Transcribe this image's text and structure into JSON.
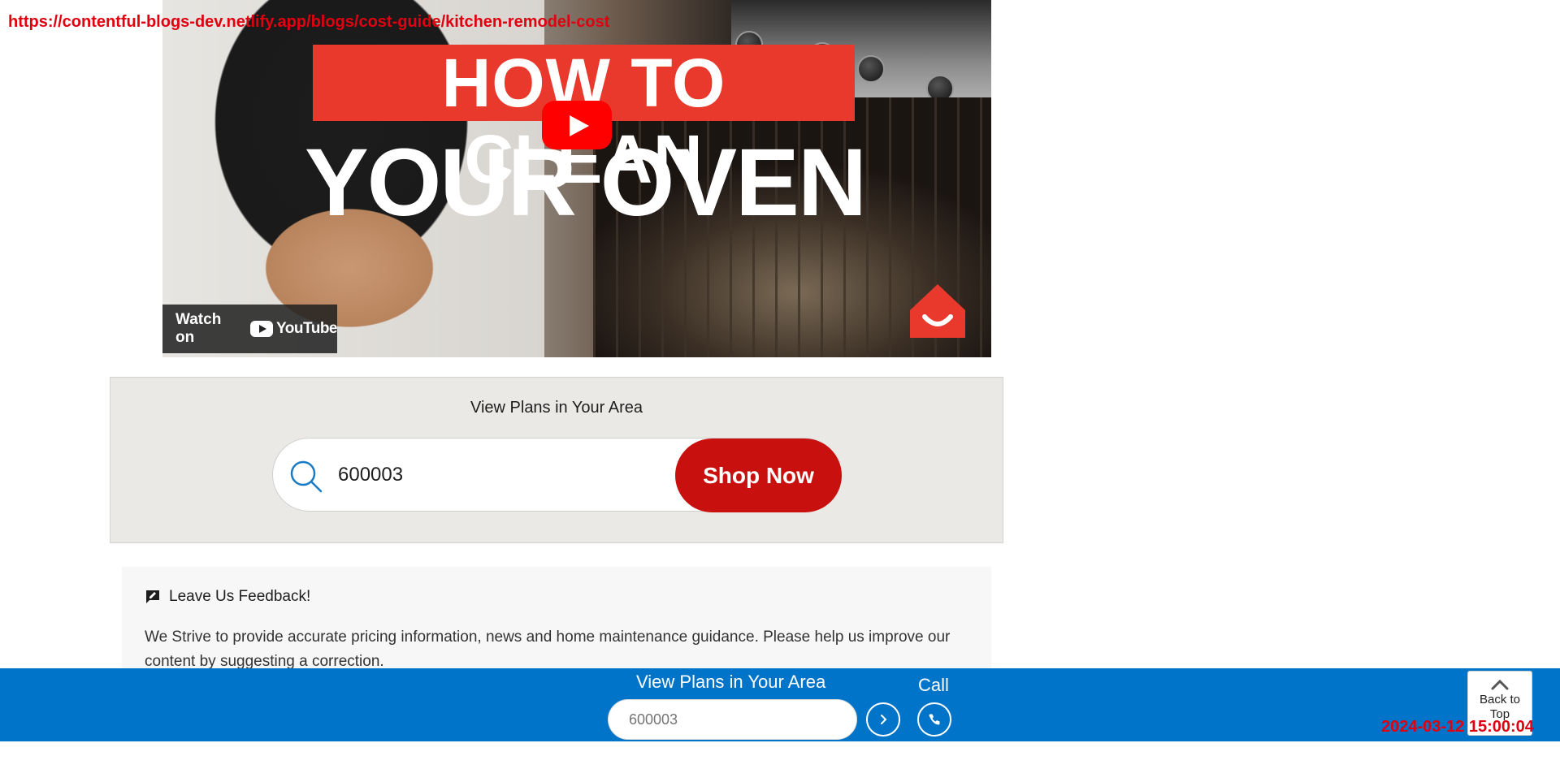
{
  "overlay": {
    "url": "https://contentful-blogs-dev.netlify.app/blogs/cost-guide/kitchen-remodel-cost",
    "timestamp": "2024-03-12 15:00:04"
  },
  "video": {
    "headline_line1": "HOW TO CLEAN",
    "headline_line2": "YOUR OVEN",
    "watch_on_label": "Watch on",
    "youtube_wordmark": "YouTube",
    "play_icon": "play-icon",
    "brand_icon": "house-smile-icon"
  },
  "plans": {
    "title": "View Plans in Your Area",
    "zip_value": "600003",
    "button_label": "Shop Now",
    "search_icon": "search-icon"
  },
  "feedback": {
    "title": "Leave Us Feedback!",
    "body": "We Strive to provide accurate pricing information, news and home maintenance guidance. Please help us improve our content by suggesting a correction.",
    "icon": "feedback-icon"
  },
  "footer": {
    "title": "View Plans in Your Area",
    "zip_placeholder": "600003",
    "call_label": "Call",
    "go_icon": "chevron-right-icon",
    "call_icon": "phone-icon"
  },
  "back_to_top": {
    "label": "Back to Top",
    "icon": "chevron-up-icon"
  },
  "colors": {
    "footer_blue": "#0074c8",
    "shop_red": "#c8110f",
    "headline_red": "#e8392c",
    "overlay_red": "#e0000f"
  }
}
